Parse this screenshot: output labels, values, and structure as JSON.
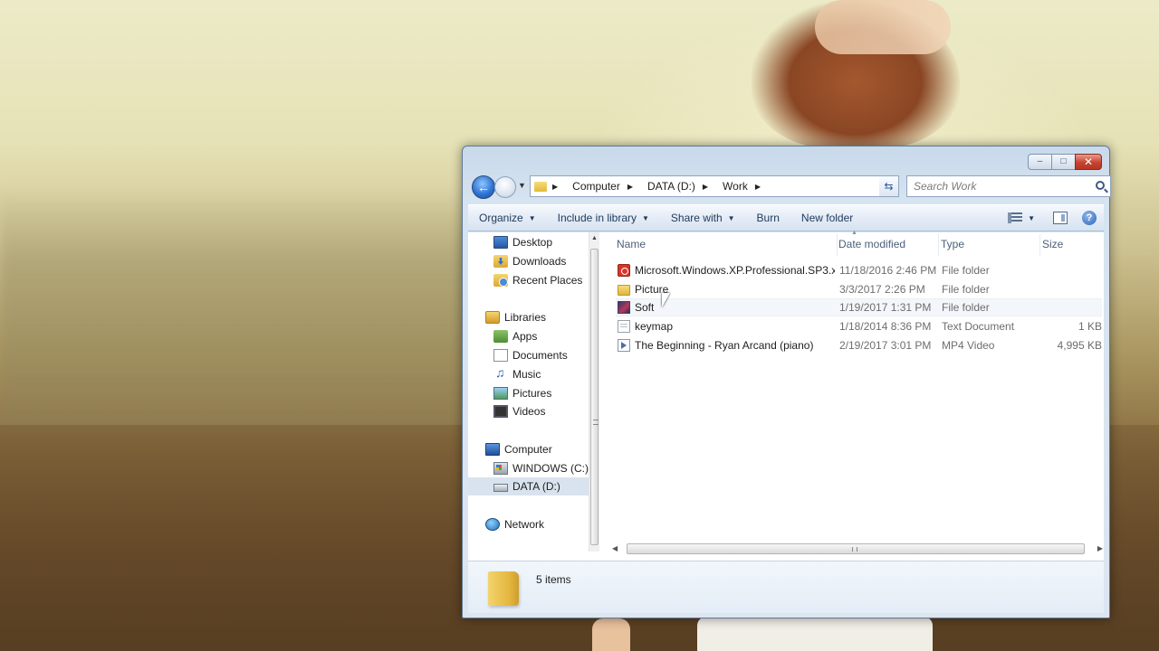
{
  "window": {
    "caption_buttons": {
      "minimize": "‒",
      "maximize": "□",
      "close": "✕"
    }
  },
  "address": {
    "breadcrumbs": [
      "Computer",
      "DATA (D:)",
      "Work"
    ]
  },
  "search": {
    "placeholder": "Search Work"
  },
  "toolbar": {
    "organize": "Organize",
    "include_in_library": "Include in library",
    "share_with": "Share with",
    "burn": "Burn",
    "new_folder": "New folder"
  },
  "nav_pane": {
    "favorites": [
      {
        "label": "Desktop",
        "icon": "desktop-icon"
      },
      {
        "label": "Downloads",
        "icon": "downloads-folder-icon"
      },
      {
        "label": "Recent Places",
        "icon": "recent-places-icon"
      }
    ],
    "libraries": {
      "label": "Libraries",
      "items": [
        {
          "label": "Apps",
          "icon": "apps-library-icon"
        },
        {
          "label": "Documents",
          "icon": "documents-library-icon"
        },
        {
          "label": "Music",
          "icon": "music-library-icon"
        },
        {
          "label": "Pictures",
          "icon": "pictures-library-icon"
        },
        {
          "label": "Videos",
          "icon": "videos-library-icon"
        }
      ]
    },
    "computer": {
      "label": "Computer",
      "items": [
        {
          "label": "WINDOWS (C:)",
          "icon": "drive-c-icon"
        },
        {
          "label": "DATA (D:)",
          "icon": "drive-d-icon",
          "selected": true
        }
      ]
    },
    "network": {
      "label": "Network",
      "icon": "network-icon"
    }
  },
  "columns": {
    "name": "Name",
    "date_modified": "Date modified",
    "type": "Type",
    "size": "Size"
  },
  "files": [
    {
      "name": "Microsoft.Windows.XP.Professional.SP3.x...",
      "date": "11/18/2016 2:46 PM",
      "type": "File folder",
      "size": "",
      "icon": "red-folder-icon"
    },
    {
      "name": "Picture",
      "date": "3/3/2017 2:26 PM",
      "type": "File folder",
      "size": "",
      "icon": "folder-icon"
    },
    {
      "name": "Soft",
      "date": "1/19/2017 1:31 PM",
      "type": "File folder",
      "size": "",
      "icon": "image-folder-icon"
    },
    {
      "name": "keymap",
      "date": "1/18/2014 8:36 PM",
      "type": "Text Document",
      "size": "1 KB",
      "icon": "text-document-icon"
    },
    {
      "name": "The Beginning - Ryan Arcand (piano)",
      "date": "2/19/2017 3:01 PM",
      "type": "MP4 Video",
      "size": "4,995 KB",
      "icon": "video-file-icon"
    }
  ],
  "details": {
    "item_count": "5 items"
  }
}
